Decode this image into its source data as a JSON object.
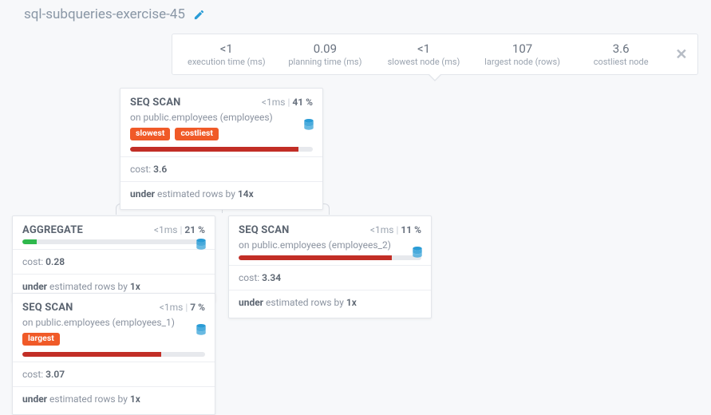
{
  "title": "sql-subqueries-exercise-45",
  "stats": {
    "exec_time": {
      "value": "<1",
      "label": "execution time (ms)"
    },
    "plan_time": {
      "value": "0.09",
      "label": "planning time (ms)"
    },
    "slowest_node": {
      "value": "<1",
      "label": "slowest node (ms)"
    },
    "largest_node": {
      "value": "107",
      "label": "largest node (rows)"
    },
    "costliest": {
      "value": "3.6",
      "label": "costliest node"
    }
  },
  "nodes": {
    "root": {
      "title": "SEQ SCAN",
      "time": "<1ms",
      "pct": "41 %",
      "subtitle_prefix": "on ",
      "subtitle": "public.employees (employees)",
      "badges": [
        "slowest",
        "costliest"
      ],
      "bar_pct": 92,
      "bar_color": "red",
      "cost_label": "cost:",
      "cost": "3.6",
      "under_label": "under",
      "under_mid": " estimated rows by ",
      "under_x": "14x",
      "show_db_icon": true
    },
    "agg": {
      "title": "AGGREGATE",
      "time": "<1ms",
      "pct": "21 %",
      "subtitle_prefix": "",
      "subtitle": "",
      "badges": [],
      "bar_pct": 8,
      "bar_color": "green",
      "cost_label": "cost:",
      "cost": "0.28",
      "under_label": "under",
      "under_mid": " estimated rows by ",
      "under_x": "1x",
      "show_db_icon": true
    },
    "seq2": {
      "title": "SEQ SCAN",
      "time": "<1ms",
      "pct": "11 %",
      "subtitle_prefix": "on ",
      "subtitle": "public.employees (employees_2)",
      "badges": [],
      "bar_pct": 84,
      "bar_color": "red",
      "cost_label": "cost:",
      "cost": "3.34",
      "under_label": "under",
      "under_mid": " estimated rows by ",
      "under_x": "1x",
      "show_db_icon": true
    },
    "seq1": {
      "title": "SEQ SCAN",
      "time": "<1ms",
      "pct": "7 %",
      "subtitle_prefix": "on ",
      "subtitle": "public.employees (employees_1)",
      "badges": [
        "largest"
      ],
      "bar_pct": 76,
      "bar_color": "red",
      "cost_label": "cost:",
      "cost": "3.07",
      "under_label": "under",
      "under_mid": " estimated rows by ",
      "under_x": "1x",
      "show_db_icon": true
    }
  }
}
